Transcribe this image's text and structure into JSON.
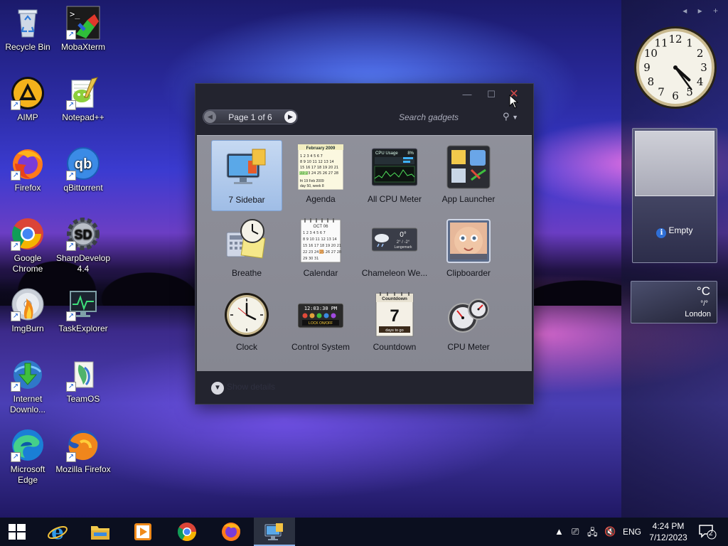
{
  "desktop": {
    "icons": [
      {
        "label": "Recycle Bin",
        "name": "recycle-bin"
      },
      {
        "label": "MobaXterm",
        "name": "mobaxterm"
      },
      {
        "label": "AIMP",
        "name": "aimp"
      },
      {
        "label": "Notepad++",
        "name": "notepad-plus-plus"
      },
      {
        "label": "Firefox",
        "name": "firefox"
      },
      {
        "label": "qBittorrent",
        "name": "qbittorrent"
      },
      {
        "label": "Google Chrome",
        "name": "google-chrome"
      },
      {
        "label": "SharpDevelop 4.4",
        "name": "sharpdevelop"
      },
      {
        "label": "ImgBurn",
        "name": "imgburn"
      },
      {
        "label": "TaskExplorer",
        "name": "taskexplorer"
      },
      {
        "label": "Internet Downlo...",
        "name": "internet-download-manager"
      },
      {
        "label": "TeamOS",
        "name": "teamos"
      },
      {
        "label": "Microsoft Edge",
        "name": "microsoft-edge"
      },
      {
        "label": "Mozilla Firefox",
        "name": "mozilla-firefox"
      }
    ]
  },
  "sidebar": {
    "nav": "◂ ▸ +",
    "clock": {
      "hour": 4,
      "minute": 24,
      "numerals": [
        "12",
        "1",
        "2",
        "3",
        "4",
        "5",
        "6",
        "7",
        "8",
        "9",
        "10",
        "11"
      ]
    },
    "slideshow": {
      "empty_label": "Empty"
    },
    "weather": {
      "temp": "°C",
      "range": "°/°",
      "city": "London"
    }
  },
  "gallery": {
    "page_label": "Page 1 of 6",
    "search_placeholder": "Search gadgets",
    "show_details_label": "Show details",
    "gadgets": [
      {
        "label": "7 Sidebar",
        "selected": true
      },
      {
        "label": "Agenda"
      },
      {
        "label": "All CPU Meter"
      },
      {
        "label": "App Launcher"
      },
      {
        "label": "Breathe"
      },
      {
        "label": "Calendar"
      },
      {
        "label": "Chameleon We..."
      },
      {
        "label": "Clipboarder"
      },
      {
        "label": "Clock"
      },
      {
        "label": "Control System"
      },
      {
        "label": "Countdown"
      },
      {
        "label": "CPU Meter"
      }
    ],
    "agenda_thumb": {
      "month": "February 2009",
      "footer": "fri 19 Feb 2009",
      "week": "day 50, week 8"
    },
    "cpu_thumb": {
      "title": "CPU Usage",
      "value": "8%"
    },
    "calendar_thumb": {
      "month": "OCT 06"
    },
    "chameleon_thumb": {
      "temp": "0°",
      "range": "2° / -2°",
      "city": "Langemark"
    },
    "control_thumb": {
      "time": "12:03:30 PM",
      "caption": "LOCK ON/OFF"
    },
    "countdown_thumb": {
      "title": "Countdown",
      "number": "7",
      "caption": "days to go"
    }
  },
  "taskbar": {
    "pinned": [
      {
        "name": "internet-explorer"
      },
      {
        "name": "file-explorer"
      },
      {
        "name": "media-player"
      },
      {
        "name": "google-chrome"
      },
      {
        "name": "firefox"
      },
      {
        "name": "gadgets",
        "active": true
      }
    ],
    "tray": {
      "language": "ENG",
      "time": "4:24 PM",
      "date": "7/12/2023",
      "notification_count": "2"
    }
  }
}
